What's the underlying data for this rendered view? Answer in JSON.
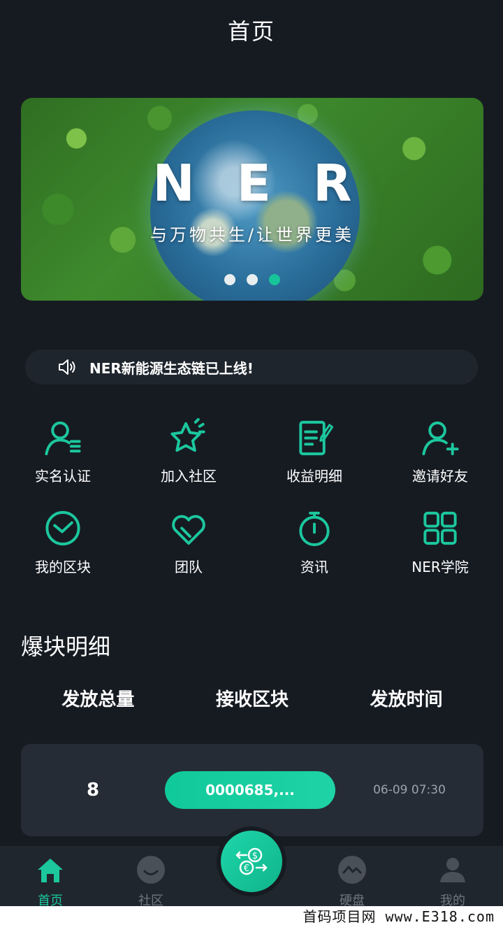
{
  "header": {
    "title": "首页"
  },
  "banner": {
    "title": "NER",
    "subtitle": "与万物共生/让世界更美",
    "slides": 3,
    "active_slide": 3
  },
  "notice": {
    "icon": "speaker-icon",
    "text": "NER新能源生态链已上线!"
  },
  "grid": [
    {
      "label": "实名认证",
      "icon": "user-verify-icon"
    },
    {
      "label": "加入社区",
      "icon": "star-icon"
    },
    {
      "label": "收益明细",
      "icon": "document-edit-icon"
    },
    {
      "label": "邀请好友",
      "icon": "user-add-icon"
    },
    {
      "label": "我的区块",
      "icon": "clock-icon"
    },
    {
      "label": "团队",
      "icon": "heart-icon"
    },
    {
      "label": "资讯",
      "icon": "stopwatch-icon"
    },
    {
      "label": "NER学院",
      "icon": "grid-icon"
    }
  ],
  "section": {
    "title": "爆块明细"
  },
  "table": {
    "headers": [
      "发放总量",
      "接收区块",
      "发放时间"
    ],
    "rows": [
      {
        "amount": "8",
        "block": "0000685,...",
        "time": "06-09 07:30"
      }
    ]
  },
  "nav": {
    "items": [
      {
        "label": "首页",
        "icon": "home-icon",
        "active": true
      },
      {
        "label": "社区",
        "icon": "smile-icon",
        "active": false
      },
      {
        "label": "硬盘",
        "icon": "chart-wave-icon",
        "active": false
      },
      {
        "label": "我的",
        "icon": "user-icon",
        "active": false
      }
    ],
    "center_icon": "currency-exchange-icon"
  },
  "watermark": "首码项目网 www.E318.com",
  "colors": {
    "accent": "#1cc79e",
    "background": "#161b22",
    "card": "#262c35"
  }
}
